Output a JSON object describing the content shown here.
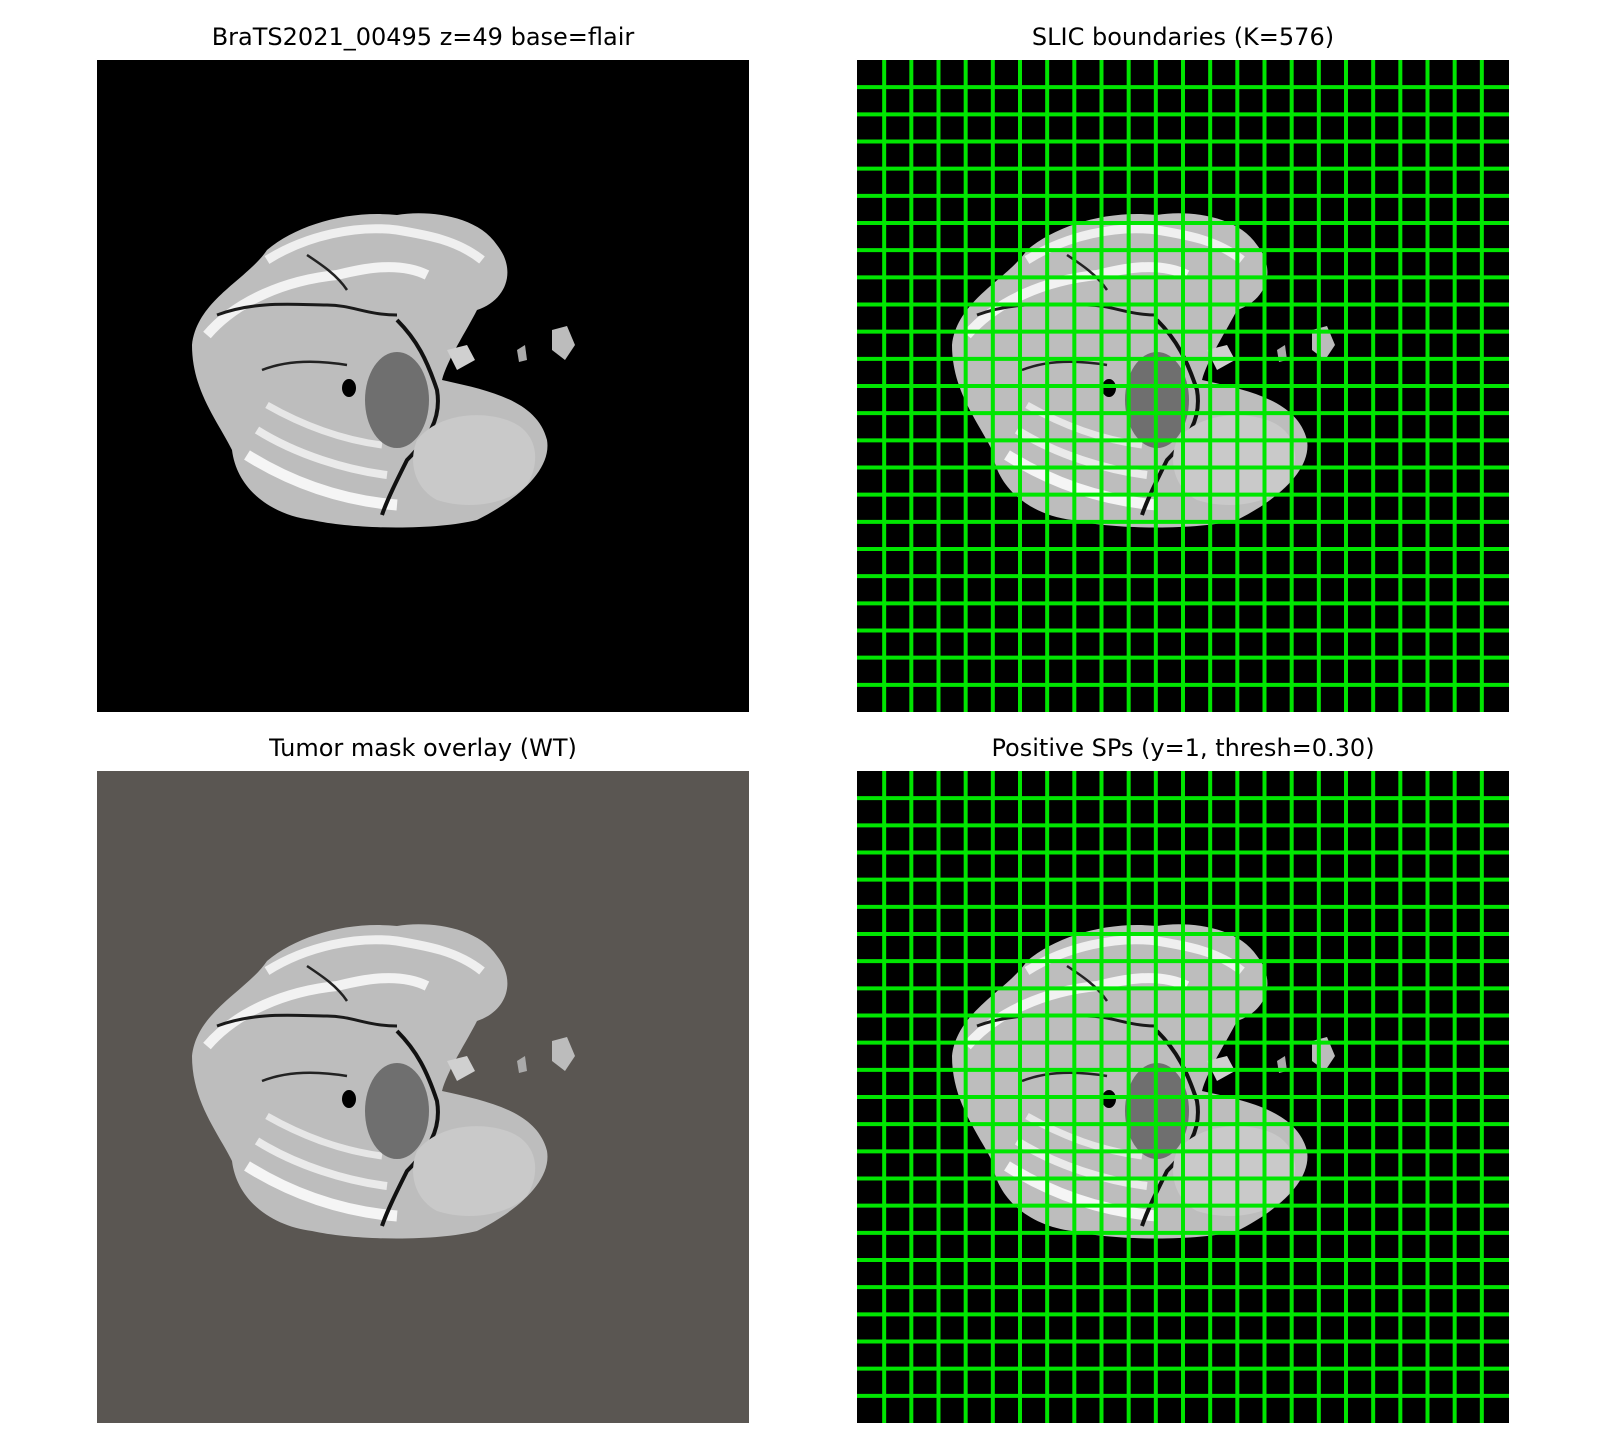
{
  "panels": [
    {
      "title": "BraTS2021_00495 z=49  base=flair"
    },
    {
      "title": "SLIC boundaries (K=576)"
    },
    {
      "title": "Tumor mask overlay (WT)"
    },
    {
      "title": "Positive SPs (y=1, thresh=0.30)"
    }
  ],
  "colors": {
    "background": "#000000",
    "overlay_tint": "#5a5652",
    "grid_line": "#00e600"
  }
}
